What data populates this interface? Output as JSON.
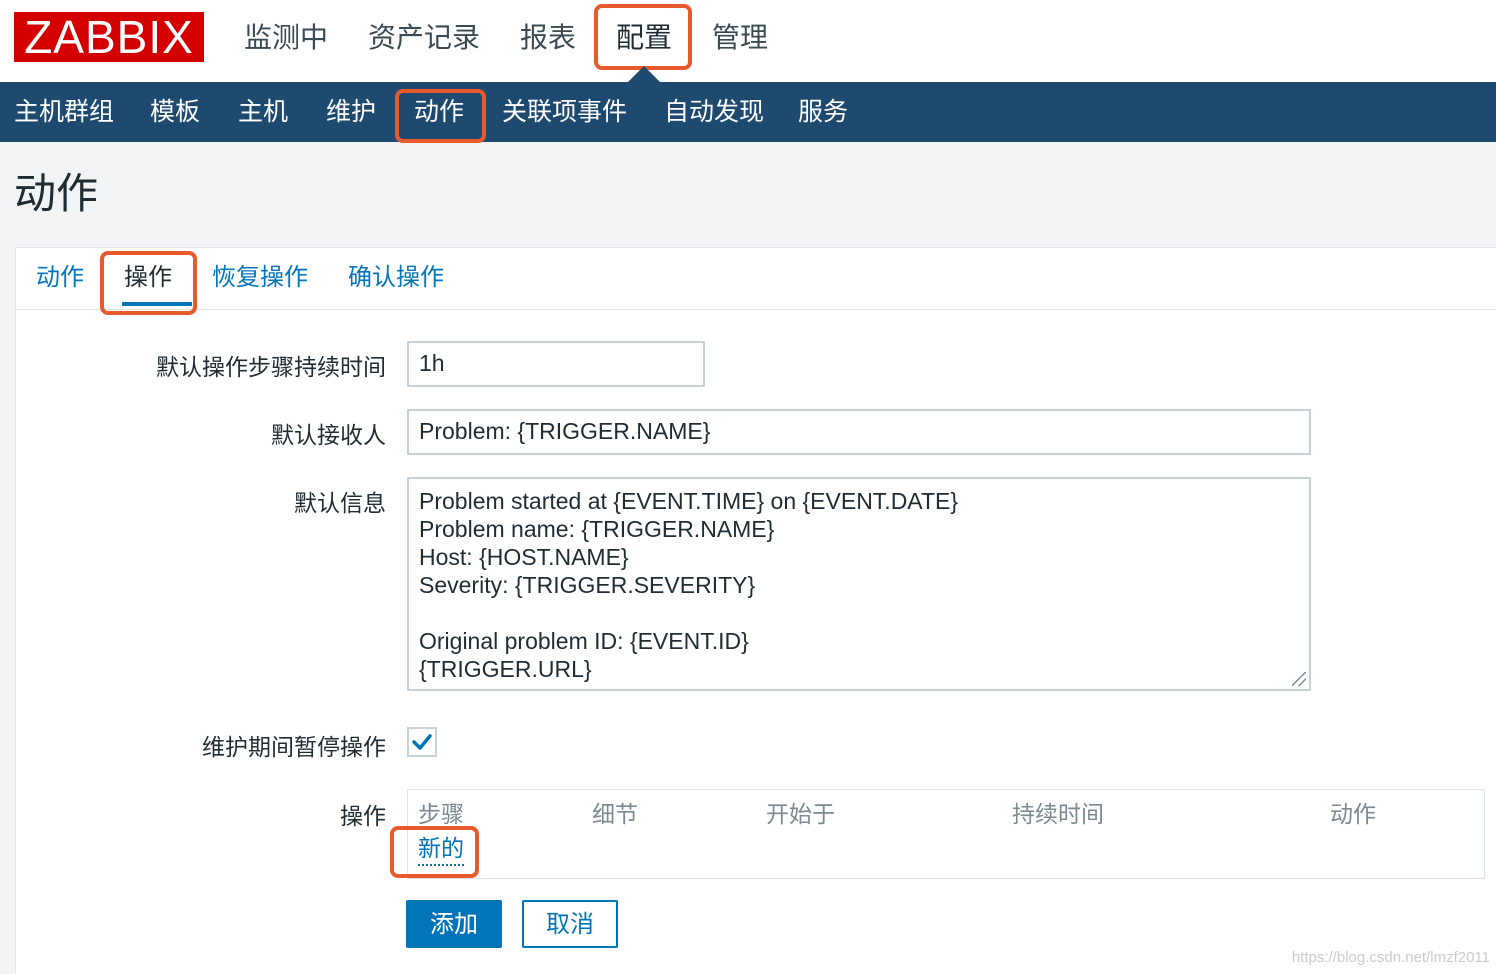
{
  "header": {
    "logo": "ZABBIX",
    "nav": [
      "监测中",
      "资产记录",
      "报表",
      "配置",
      "管理"
    ],
    "active": "配置"
  },
  "subnav": {
    "items": [
      "主机群组",
      "模板",
      "主机",
      "维护",
      "动作",
      "关联项事件",
      "自动发现",
      "服务"
    ],
    "active": "动作"
  },
  "page": {
    "title": "动作"
  },
  "tabs": {
    "items": [
      "动作",
      "操作",
      "恢复操作",
      "确认操作"
    ],
    "active": "操作"
  },
  "form": {
    "step_duration": {
      "label": "默认操作步骤持续时间",
      "value": "1h"
    },
    "recipient": {
      "label": "默认接收人",
      "value": "Problem: {TRIGGER.NAME}"
    },
    "message": {
      "label": "默认信息",
      "value": "Problem started at {EVENT.TIME} on {EVENT.DATE}\nProblem name: {TRIGGER.NAME}\nHost: {HOST.NAME}\nSeverity: {TRIGGER.SEVERITY}\n\nOriginal problem ID: {EVENT.ID}\n{TRIGGER.URL}"
    },
    "pause": {
      "label": "维护期间暂停操作",
      "checked": true
    },
    "operations": {
      "label": "操作",
      "columns": [
        "步骤",
        "细节",
        "开始于",
        "持续时间",
        "动作"
      ],
      "new_link": "新的"
    }
  },
  "buttons": {
    "add": "添加",
    "cancel": "取消"
  },
  "watermark": "https://blog.csdn.net/lmzf2011",
  "colors": {
    "brand": "#d40000",
    "nav_bg": "#1f4a70",
    "link": "#0275b8",
    "highlight": "#e85a2b"
  }
}
